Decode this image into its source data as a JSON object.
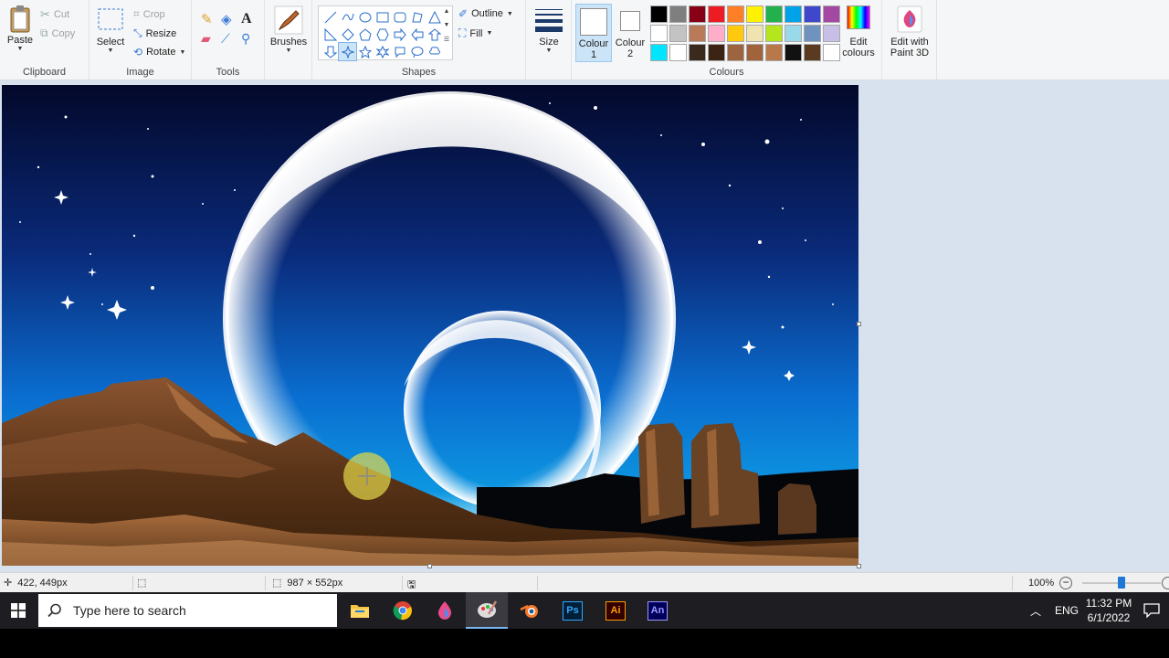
{
  "ribbon": {
    "clipboard": {
      "paste": "Paste",
      "cut": "Cut",
      "copy": "Copy",
      "label": "Clipboard"
    },
    "image": {
      "select": "Select",
      "crop": "Crop",
      "resize": "Resize",
      "rotate": "Rotate",
      "label": "Image"
    },
    "tools": {
      "label": "Tools"
    },
    "brushes": {
      "label": "Brushes"
    },
    "shapes": {
      "outline": "Outline",
      "fill": "Fill",
      "label": "Shapes"
    },
    "size": {
      "label": "Size"
    },
    "colours": {
      "colour1_line1": "Colour",
      "colour1_line2": "1",
      "colour2_line1": "Colour",
      "colour2_line2": "2",
      "label": "Colours",
      "edit_line1": "Edit",
      "edit_line2": "colours",
      "paint3d_line1": "Edit with",
      "paint3d_line2": "Paint 3D",
      "palette": [
        "#000000",
        "#7f7f7f",
        "#880015",
        "#ed1c24",
        "#ff7f27",
        "#fff200",
        "#22b14c",
        "#00a2e8",
        "#3f48cc",
        "#a349a4",
        "#ffffff",
        "#c3c3c3",
        "#b97a57",
        "#ffaec9",
        "#ffc90e",
        "#efe4b0",
        "#b5e61d",
        "#99d9ea",
        "#7092be",
        "#c8bfe7",
        "#00e5ff",
        "#ffffff",
        "#3a2a1e",
        "#3b2414",
        "#9c6540",
        "#a0633b",
        "#b8784a",
        "#111111",
        "#5a3a20",
        "#ffffff"
      ]
    }
  },
  "status": {
    "cursor_pos": "422, 449px",
    "image_size": "987 × 552px",
    "zoom": "100%",
    "zoom_level": 0.5
  },
  "taskbar": {
    "search_placeholder": "Type here to search",
    "apps": [
      "file-explorer",
      "chrome",
      "paint-3d-drop",
      "paint",
      "blender",
      "photoshop",
      "illustrator",
      "animate"
    ],
    "ps": "Ps",
    "ai": "Ai",
    "an": "An",
    "lang": "ENG",
    "time": "11:32 PM",
    "date": "6/1/2022"
  }
}
